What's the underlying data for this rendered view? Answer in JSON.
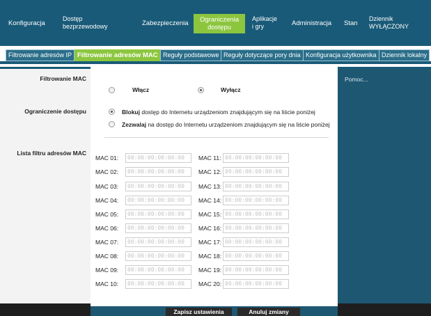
{
  "nav": {
    "items": [
      {
        "label": "Konfiguracja"
      },
      {
        "label": "Dostęp\nbezprzewodowy"
      },
      {
        "label": "Zabezpieczenia"
      },
      {
        "label": "Ograniczenia\ndostępu"
      },
      {
        "label": "Aplikacje\ni gry"
      },
      {
        "label": "Administracja"
      },
      {
        "label": "Stan"
      },
      {
        "label": "Dziennik\nWYŁĄCZONY"
      }
    ]
  },
  "subtabs": [
    {
      "label": "Filtrowanie adresów IP"
    },
    {
      "label": "Filtrowanie adresów MAC"
    },
    {
      "label": "Reguły podstawowe"
    },
    {
      "label": "Reguły dotyczące pory dnia"
    },
    {
      "label": "Konfiguracja użytkownika"
    },
    {
      "label": "Dziennik lokalny"
    }
  ],
  "left": {
    "section_title": "Filtrowanie MAC",
    "access_label": "Ograniczenie dostępu",
    "mac_list_label": "Lista filtru adresów MAC"
  },
  "filter": {
    "enable_label": "Włącz",
    "disable_label": "Wyłącz",
    "selected": "Wyłącz"
  },
  "access": {
    "block_bold": "Blokuj",
    "block_rest": " dostęp do Internetu urządzeniom znajdującym się na liście poniżej",
    "allow_bold": "Zezwalaj",
    "allow_rest": " na dostęp do Internetu urządzeniom znajdującym się na liście poniżej",
    "selected": "Blokuj"
  },
  "mac": {
    "placeholder": "00:00:00:00:00:00",
    "left": [
      {
        "label": "MAC 01:",
        "value": ""
      },
      {
        "label": "MAC 02:",
        "value": ""
      },
      {
        "label": "MAC 03:",
        "value": ""
      },
      {
        "label": "MAC 04:",
        "value": ""
      },
      {
        "label": "MAC 05:",
        "value": ""
      },
      {
        "label": "MAC 06:",
        "value": ""
      },
      {
        "label": "MAC 07:",
        "value": ""
      },
      {
        "label": "MAC 08:",
        "value": ""
      },
      {
        "label": "MAC 09:",
        "value": ""
      },
      {
        "label": "MAC 10:",
        "value": ""
      }
    ],
    "right": [
      {
        "label": "MAC 11:",
        "value": ""
      },
      {
        "label": "MAC 12:",
        "value": ""
      },
      {
        "label": "MAC 13:",
        "value": ""
      },
      {
        "label": "MAC 14:",
        "value": ""
      },
      {
        "label": "MAC 15:",
        "value": ""
      },
      {
        "label": "MAC 16:",
        "value": ""
      },
      {
        "label": "MAC 17:",
        "value": ""
      },
      {
        "label": "MAC 18:",
        "value": ""
      },
      {
        "label": "MAC 19:",
        "value": ""
      },
      {
        "label": "MAC 20:",
        "value": ""
      }
    ]
  },
  "buttons": {
    "save": "Zapisz ustawienia",
    "cancel": "Anuluj zmiany"
  },
  "help": {
    "title": "Pomoc..."
  },
  "colors": {
    "nav_bg": "#195a78",
    "active_green": "#8cc63f",
    "help_bg": "#1e5772"
  }
}
